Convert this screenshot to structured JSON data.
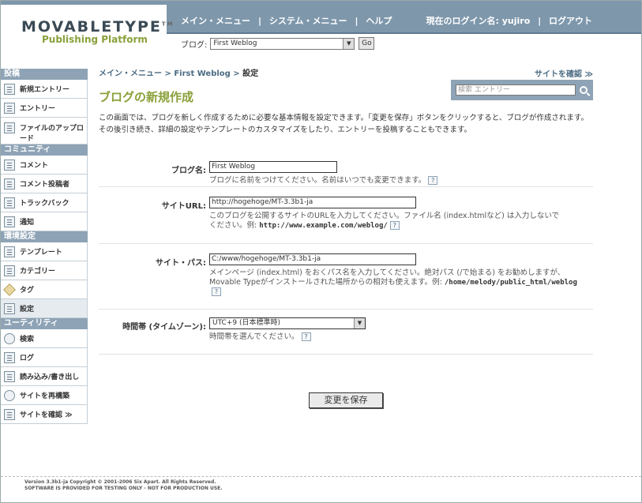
{
  "header": {
    "logo_main": "MOVABLETYPE",
    "logo_tm": "TM",
    "logo_sub": "Publishing Platform",
    "nav": [
      "メイン・メニュー",
      "システム・メニュー",
      "ヘルプ"
    ],
    "current_login_label": "現在のログイン名:",
    "username": "yujiro",
    "logout": "ログアウト",
    "blog_label": "ブログ:",
    "blog_selected": "First Weblog",
    "go_label": "Go"
  },
  "sidebar": {
    "sections": [
      {
        "title": "投稿",
        "items": [
          "新規エントリー",
          "エントリー",
          "ファイルのアップロード"
        ]
      },
      {
        "title": "コミュニティ",
        "items": [
          "コメント",
          "コメント投稿者",
          "トラックバック",
          "通知"
        ]
      },
      {
        "title": "環境設定",
        "items": [
          "テンプレート",
          "カテゴリー",
          "タグ",
          "設定"
        ]
      },
      {
        "title": "ユーティリティ",
        "items": [
          "検索",
          "ログ",
          "読み込み/書き出し",
          "サイトを再構築",
          "サイトを確認 ≫"
        ]
      }
    ]
  },
  "main": {
    "breadcrumb": [
      "メイン・メニュー",
      "First Weblog",
      "設定"
    ],
    "site_check": "サイトを確認 ≫",
    "search_placeholder": "検索 エントリー",
    "title": "ブログの新規作成",
    "intro": "この画面では、ブログを新しく作成するために必要な基本情報を設定できます。「変更を保存」ボタンをクリックすると、ブログが作成されます。その後引き続き、詳細の設定やテンプレートのカスタマイズをしたり、エントリーを投稿することもできます。",
    "fields": {
      "blog_name": {
        "label": "ブログ名:",
        "value": "First Weblog",
        "hint": "ブログに名前をつけてください。名前はいつでも変更できます。"
      },
      "site_url": {
        "label": "サイトURL:",
        "value": "http://hogehoge/MT-3.3b1-ja",
        "hint": "このブログを公開するサイトのURLを入力してください。ファイル名 (index.htmlなど) は入力しないでください。例: ",
        "example": "http://www.example.com/weblog/"
      },
      "site_path": {
        "label": "サイト・パス:",
        "value": "C:/www/hogehoge/MT-3.3b1-ja",
        "hint": "メインページ (index.html) をおくパス名を入力してください。絶対パス (/で始まる) をお勧めしますが、Movable Typeがインストールされた場所からの相対も使えます。例: ",
        "example": "/home/melody/public_html/weblog"
      },
      "timezone": {
        "label": "時間帯 (タイムゾーン):",
        "value": "UTC+9 (日本標準時)",
        "hint": "時間帯を選んでください。"
      }
    },
    "help_glyph": "?",
    "save_button": "変更を保存"
  },
  "footer": {
    "line1": "Version 3.3b1-ja Copyright © 2001-2006 Six Apart. All Rights Reserved.",
    "line2": "SOFTWARE IS PROVIDED FOR TESTING ONLY - NOT FOR PRODUCTION USE."
  }
}
